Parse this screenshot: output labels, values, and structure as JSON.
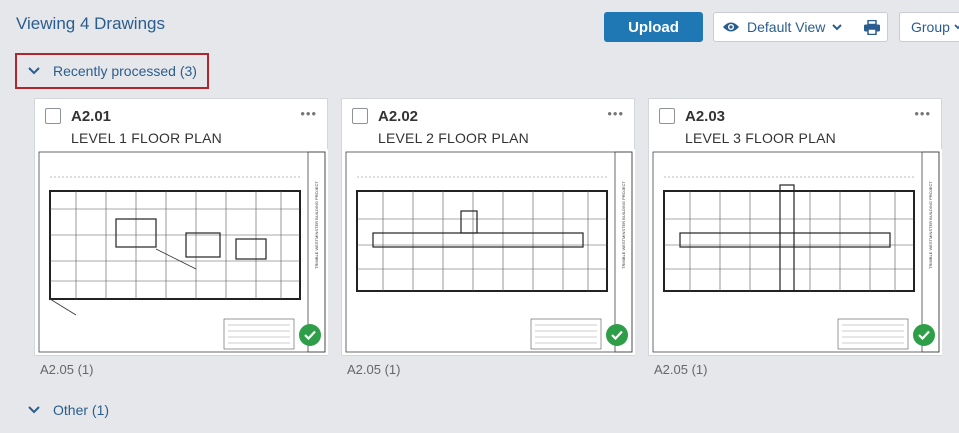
{
  "header": {
    "title": "Viewing 4 Drawings",
    "upload_label": "Upload",
    "view_label": "Default View",
    "group_label": "Group"
  },
  "sections": [
    {
      "label": "Recently processed (3)",
      "expanded": true
    },
    {
      "label": "Other (1)",
      "expanded": false
    }
  ],
  "cards": [
    {
      "number": "A2.01",
      "title": "LEVEL 1 FLOOR PLAN",
      "footer": "A2.05 (1)",
      "processed": true
    },
    {
      "number": "A2.02",
      "title": "LEVEL 2 FLOOR PLAN",
      "footer": "A2.05 (1)",
      "processed": true
    },
    {
      "number": "A2.03",
      "title": "LEVEL 3 FLOOR PLAN",
      "footer": "A2.05 (1)",
      "processed": true
    }
  ],
  "colors": {
    "accent": "#1f78b4",
    "link": "#2a5d8f",
    "highlight_border": "#b0262e",
    "success": "#2f9e48",
    "background": "#e6e7ea"
  },
  "icons": {
    "view": "eye-icon",
    "print": "printer-icon",
    "dropdown": "chevron-down-icon",
    "more": "ellipsis-icon",
    "status": "check-circle-icon"
  }
}
